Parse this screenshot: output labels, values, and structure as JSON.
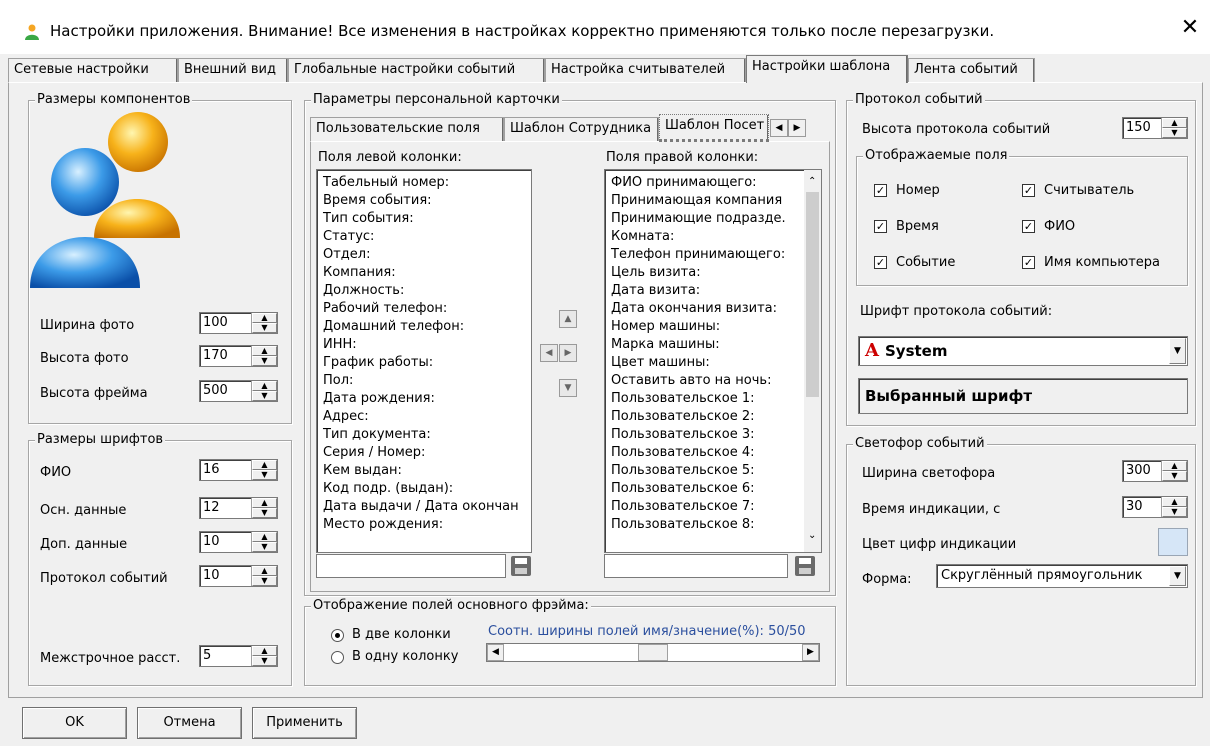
{
  "window": {
    "title": "Настройки приложения. Внимание! Все изменения в настройках корректно применяются только после перезагрузки.",
    "close": "✕"
  },
  "tabs": [
    "Сетевые настройки",
    "Внешний вид",
    "Глобальные настройки событий",
    "Настройка считывателей",
    "Настройки шаблона",
    "Лента событий"
  ],
  "left": {
    "sizes_legend": "Размеры компонентов",
    "photo_width_label": "Ширина фото",
    "photo_width": "100",
    "photo_height_label": "Высота фото",
    "photo_height": "170",
    "frame_height_label": "Высота фрейма",
    "frame_height": "500",
    "fonts_legend": "Размеры шрифтов",
    "fio_label": "ФИО",
    "fio": "16",
    "main_label": "Осн. данные",
    "main": "12",
    "extra_label": "Доп. данные",
    "extra": "10",
    "protocol_label": "Протокол событий",
    "protocol": "10",
    "line_spacing_label": "Межстрочное расст.",
    "line_spacing": "5"
  },
  "card": {
    "legend": "Параметры персональной карточки",
    "subtabs": [
      "Пользовательские поля",
      "Шаблон Сотрудника",
      "Шаблон Посет"
    ],
    "left_col_label": "Поля левой колонки:",
    "right_col_label": "Поля правой колонки:",
    "left_fields": [
      "Табельный номер:",
      "Время события:",
      "Тип события:",
      "Статус:",
      "Отдел:",
      "Компания:",
      "Должность:",
      "Рабочий телефон:",
      "Домашний телефон:",
      "ИНН:",
      "График работы:",
      "Пол:",
      "Дата рождения:",
      "Адрес:",
      "Тип документа:",
      "Серия / Номер:",
      "Кем выдан:",
      "Код подр. (выдан):",
      "Дата выдачи / Дата окончан",
      "Место рождения:"
    ],
    "right_fields": [
      "ФИО принимающего:",
      "Принимающая компания",
      "Принимающие подразде.",
      "Комната:",
      "Телефон принимающего:",
      "Цель визита:",
      "Дата визита:",
      "Дата окончания визита:",
      "Номер машины:",
      "Марка машины:",
      "Цвет машины:",
      "Оставить авто на ночь:",
      "Пользовательское 1:",
      "Пользовательское 2:",
      "Пользовательское 3:",
      "Пользовательское 4:",
      "Пользовательское 5:",
      "Пользовательское 6:",
      "Пользовательское 7:",
      "Пользовательское 8:"
    ],
    "display_legend": "Отображение полей основного фрэйма:",
    "two_cols": "В две колонки",
    "one_col": "В одну колонку",
    "ratio_label": "Соотн. ширины полей имя/значение(%): 50/50",
    "ratio_value": 50
  },
  "right": {
    "protocol_legend": "Протокол событий",
    "protocol_height_label": "Высота протокола событий",
    "protocol_height": "150",
    "fields_legend": "Отображаемые поля",
    "fields": [
      "Номер",
      "Считыватель",
      "Время",
      "ФИО",
      "Событие",
      "Имя компьютера"
    ],
    "font_label": "Шрифт протокола событий:",
    "font_value": "System",
    "font_preview": "Выбранный шрифт",
    "traffic_legend": "Светофор событий",
    "traffic_width_label": "Ширина светофора",
    "traffic_width": "300",
    "indication_time_label": "Время индикации, с",
    "indication_time": "30",
    "digit_color_label": "Цвет цифр индикации",
    "digit_color": "#d6e6f7",
    "shape_label": "Форма:",
    "shape_value": "Скруглённый прямоугольник"
  },
  "buttons": {
    "ok": "OK",
    "cancel": "Отмена",
    "apply": "Применить"
  }
}
